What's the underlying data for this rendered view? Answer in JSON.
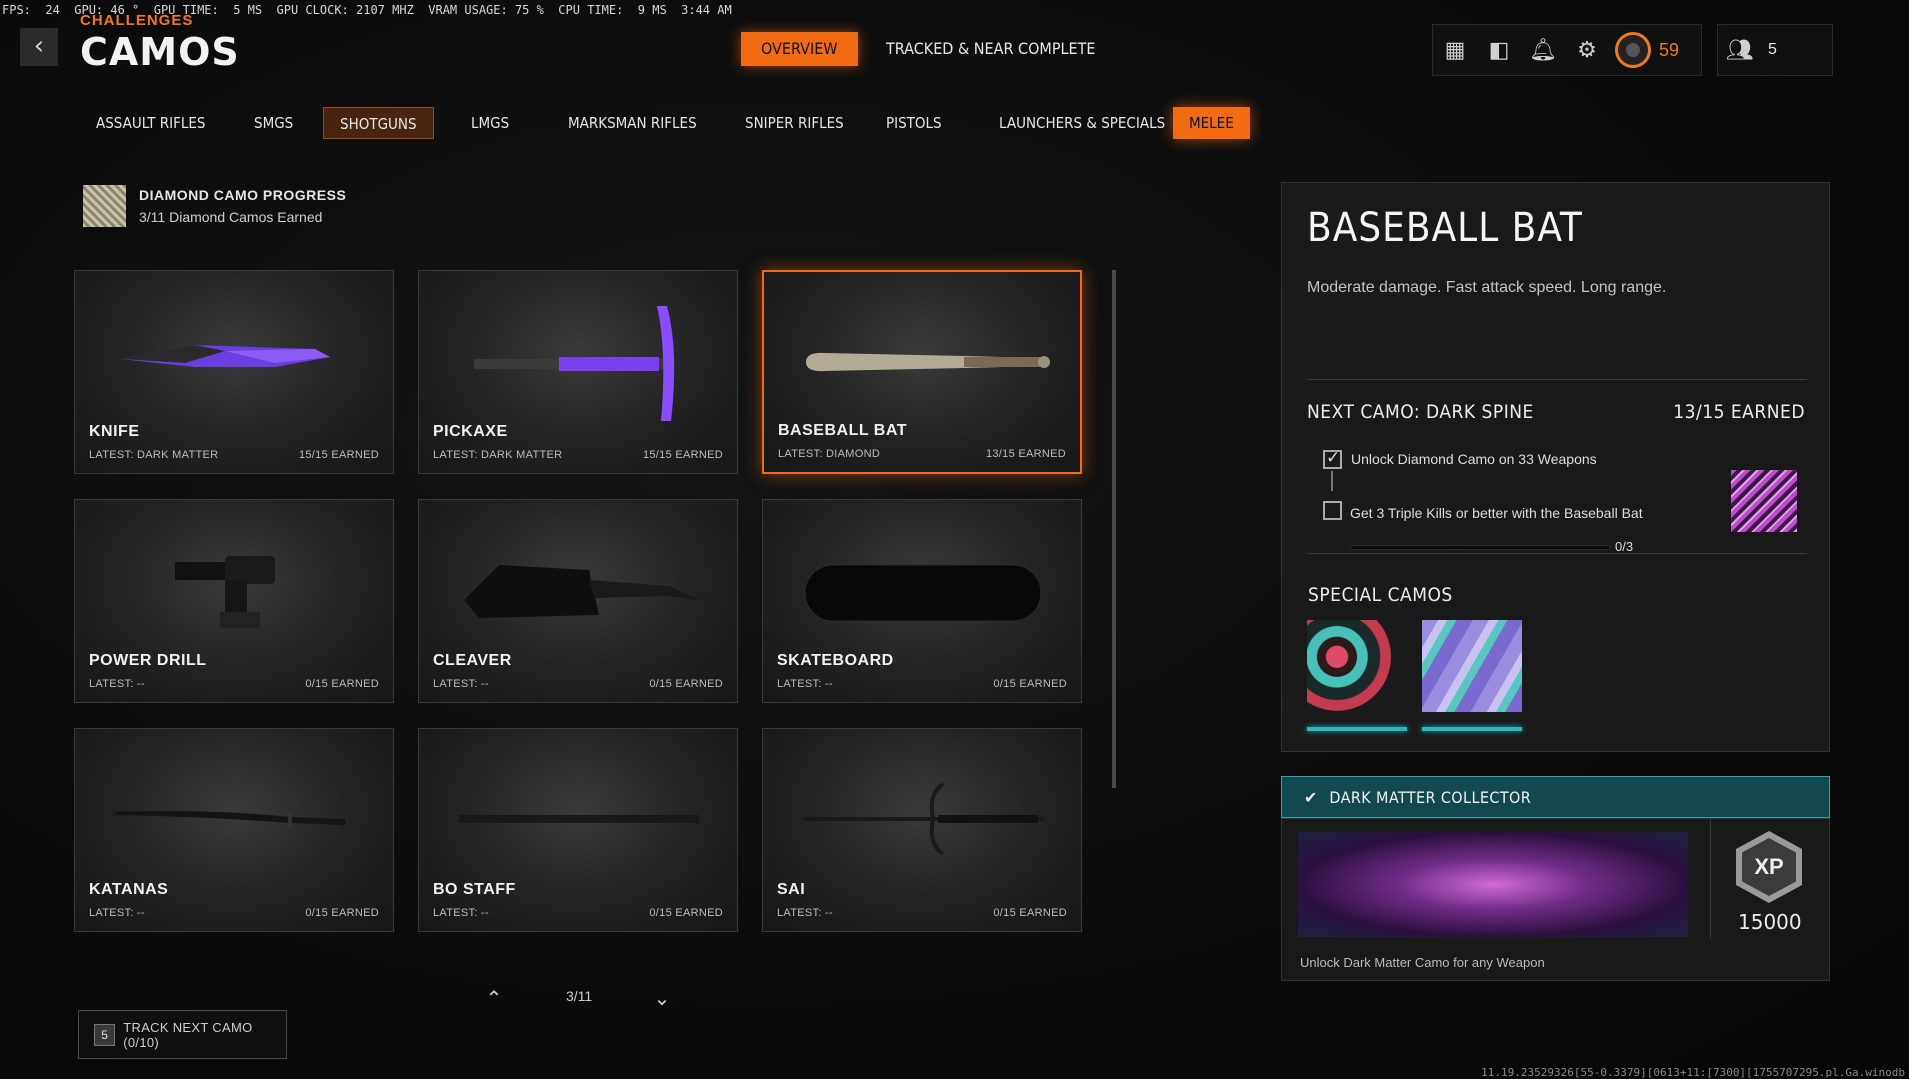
{
  "perf_overlay": "FPS:  24  GPU: 46 °  GPU TIME:  5 MS  GPU CLOCK: 2107 MHZ  VRAM USAGE: 75 %  CPU TIME:  9 MS  3:44 AM",
  "header": {
    "back_icon": "chevron-left-icon",
    "title_small": "CHALLENGES",
    "title": "CAMOS",
    "tabs": [
      {
        "label": "OVERVIEW",
        "active": true
      },
      {
        "label": "TRACKED & NEAR COMPLETE",
        "active": false
      }
    ],
    "topbar": {
      "icons": [
        "grid-icon",
        "controller-icon",
        "bell-icon",
        "gear-icon"
      ],
      "level": "59",
      "party_count": "5",
      "accent_color": "#f26b12"
    }
  },
  "categories": [
    {
      "label": "ASSAULT RIFLES",
      "state": "normal"
    },
    {
      "label": "SMGS",
      "state": "normal"
    },
    {
      "label": "SHOTGUNS",
      "state": "dim"
    },
    {
      "label": "LMGS",
      "state": "normal"
    },
    {
      "label": "MARKSMAN RIFLES",
      "state": "normal"
    },
    {
      "label": "SNIPER RIFLES",
      "state": "normal"
    },
    {
      "label": "PISTOLS",
      "state": "normal"
    },
    {
      "label": "LAUNCHERS & SPECIALS",
      "state": "normal"
    },
    {
      "label": "MELEE",
      "state": "active"
    }
  ],
  "diamond_progress": {
    "title": "DIAMOND CAMO PROGRESS",
    "subtitle": "3/11 Diamond Camos Earned"
  },
  "weapons": [
    {
      "name": "KNIFE",
      "latest": "LATEST: DARK MATTER",
      "earned": "15/15 EARNED"
    },
    {
      "name": "PICKAXE",
      "latest": "LATEST: DARK MATTER",
      "earned": "15/15 EARNED"
    },
    {
      "name": "BASEBALL BAT",
      "latest": "LATEST: DIAMOND",
      "earned": "13/15 EARNED"
    },
    {
      "name": "POWER DRILL",
      "latest": "LATEST: --",
      "earned": "0/15 EARNED"
    },
    {
      "name": "CLEAVER",
      "latest": "LATEST: --",
      "earned": "0/15 EARNED"
    },
    {
      "name": "SKATEBOARD",
      "latest": "LATEST: --",
      "earned": "0/15 EARNED"
    },
    {
      "name": "KATANAS",
      "latest": "LATEST: --",
      "earned": "0/15 EARNED"
    },
    {
      "name": "BO STAFF",
      "latest": "LATEST: --",
      "earned": "0/15 EARNED"
    },
    {
      "name": "SAI",
      "latest": "LATEST: --",
      "earned": "0/15 EARNED"
    }
  ],
  "pager": {
    "label": "3/11"
  },
  "track_button": {
    "key": "5",
    "label": "TRACK NEXT CAMO (0/10)"
  },
  "detail": {
    "name": "BASEBALL BAT",
    "description": "Moderate damage.  Fast attack speed. Long range.",
    "next_camo_label": "NEXT CAMO: DARK SPINE",
    "next_camo_earned": "13/15 EARNED",
    "challenges": [
      {
        "text": "Unlock Diamond Camo on 33 Weapons",
        "done": true
      },
      {
        "text": "Get 3 Triple Kills or better with the Baseball Bat",
        "done": false
      }
    ],
    "progress": {
      "text": "0/3",
      "fraction": 0
    },
    "special_title": "SPECIAL CAMOS"
  },
  "collector": {
    "title": "DARK MATTER COLLECTOR",
    "xp_label": "XP",
    "xp_amount": "15000",
    "description": "Unlock Dark Matter Camo for any Weapon"
  },
  "build_info": "11.19.23529326[55-0.3379][0613+11:[7300][1755707295.pl.Ga.winodb"
}
